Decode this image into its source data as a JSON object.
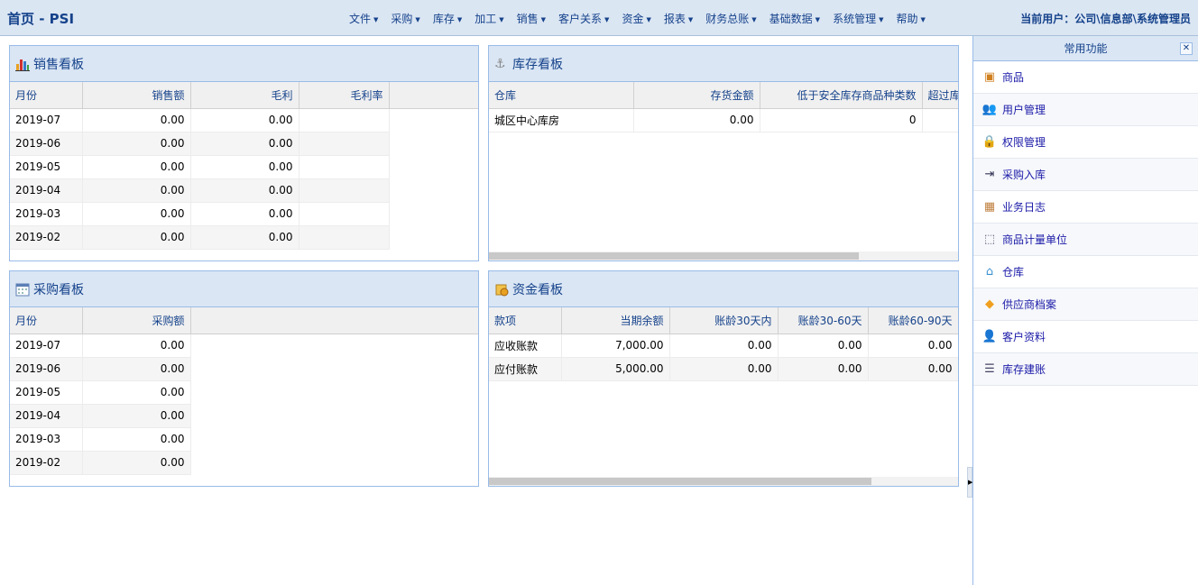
{
  "header": {
    "title": "首页 - PSI",
    "menu": [
      "文件",
      "采购",
      "库存",
      "加工",
      "销售",
      "客户关系",
      "资金",
      "报表",
      "财务总账",
      "基础数据",
      "系统管理",
      "帮助"
    ],
    "user": "当前用户：公司\\信息部\\系统管理员"
  },
  "sales": {
    "title": "销售看板",
    "icon": "bar-chart-icon",
    "columns": [
      "月份",
      "销售额",
      "毛利",
      "毛利率"
    ],
    "rows": [
      [
        "2019-07",
        "0.00",
        "0.00",
        ""
      ],
      [
        "2019-06",
        "0.00",
        "0.00",
        ""
      ],
      [
        "2019-05",
        "0.00",
        "0.00",
        ""
      ],
      [
        "2019-04",
        "0.00",
        "0.00",
        ""
      ],
      [
        "2019-03",
        "0.00",
        "0.00",
        ""
      ],
      [
        "2019-02",
        "0.00",
        "0.00",
        ""
      ]
    ]
  },
  "inventory": {
    "title": "库存看板",
    "icon": "anchor-icon",
    "columns": [
      "仓库",
      "存货金额",
      "低于安全库存商品种类数",
      "超过库存上限商品种类数"
    ],
    "rows": [
      [
        "城区中心库房",
        "0.00",
        "0",
        ""
      ]
    ]
  },
  "purchase": {
    "title": "采购看板",
    "icon": "calendar-icon",
    "columns": [
      "月份",
      "采购额"
    ],
    "rows": [
      [
        "2019-07",
        "0.00"
      ],
      [
        "2019-06",
        "0.00"
      ],
      [
        "2019-05",
        "0.00"
      ],
      [
        "2019-04",
        "0.00"
      ],
      [
        "2019-03",
        "0.00"
      ],
      [
        "2019-02",
        "0.00"
      ]
    ]
  },
  "funds": {
    "title": "资金看板",
    "icon": "money-icon",
    "columns": [
      "款项",
      "当期余额",
      "账龄30天内",
      "账龄30-60天",
      "账龄60-90天"
    ],
    "rows": [
      [
        "应收账款",
        "7,000.00",
        "0.00",
        "0.00",
        "0.00"
      ],
      [
        "应付账款",
        "5,000.00",
        "0.00",
        "0.00",
        "0.00"
      ]
    ]
  },
  "sidebar": {
    "title": "常用功能",
    "close": "✕",
    "items": [
      {
        "label": "商品",
        "icon": "goods-icon"
      },
      {
        "label": "用户管理",
        "icon": "users-icon"
      },
      {
        "label": "权限管理",
        "icon": "lock-icon"
      },
      {
        "label": "采购入库",
        "icon": "purchase-in-icon"
      },
      {
        "label": "业务日志",
        "icon": "log-icon"
      },
      {
        "label": "商品计量单位",
        "icon": "unit-icon"
      },
      {
        "label": "仓库",
        "icon": "warehouse-icon"
      },
      {
        "label": "供应商档案",
        "icon": "box-icon"
      },
      {
        "label": "客户资料",
        "icon": "customer-icon"
      },
      {
        "label": "库存建账",
        "icon": "list-icon"
      }
    ]
  }
}
